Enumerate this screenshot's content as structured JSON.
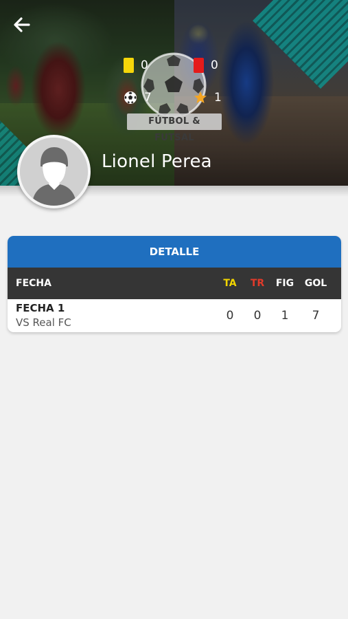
{
  "hero": {
    "logo_text": "FÚTBOL & FUTSAL",
    "player_name": "Lionel Perea",
    "stats": {
      "yellow_cards": "0",
      "red_cards": "0",
      "goals": "7",
      "figure": "1"
    }
  },
  "detail": {
    "title": "DETALLE",
    "columns": {
      "fecha": "FECHA",
      "ta": "TA",
      "tr": "TR",
      "fig": "FIG",
      "gol": "GOL"
    },
    "rows": [
      {
        "fecha": "FECHA 1",
        "rival": "VS Real FC",
        "ta": "0",
        "tr": "0",
        "fig": "1",
        "gol": "7"
      }
    ]
  },
  "colors": {
    "primary_blue": "#1f6fbf",
    "header_dark": "#353535",
    "yellow_card": "#f5d60a",
    "red_card": "#e41b1b",
    "teal_accent": "#0f8f8a"
  },
  "icons": {
    "back": "arrow-left-icon",
    "yellow": "yellow-card-icon",
    "red": "red-card-icon",
    "goals": "soccer-ball-icon",
    "figure": "star-icon",
    "avatar": "user-silhouette-icon"
  }
}
